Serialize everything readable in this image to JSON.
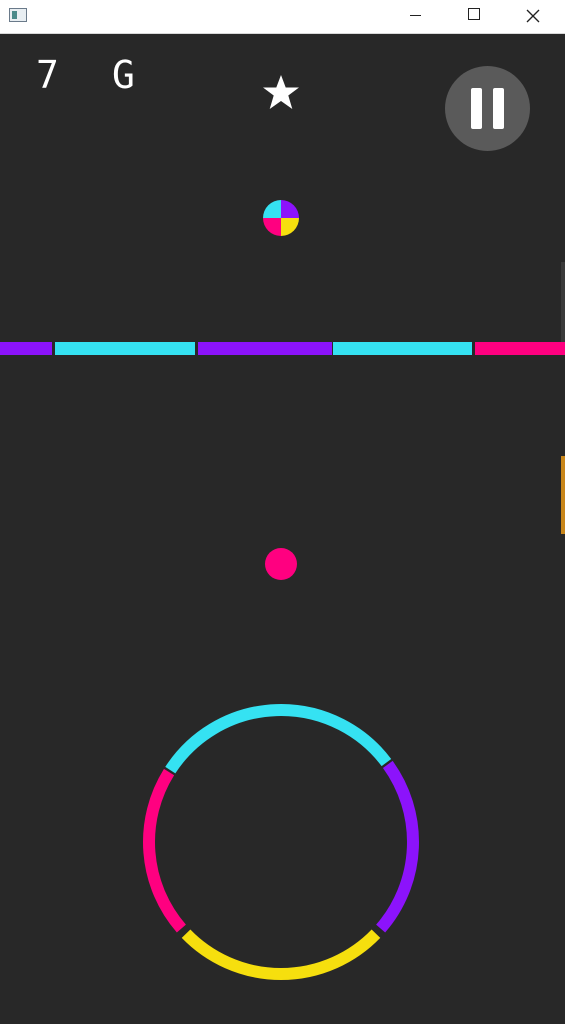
{
  "window": {
    "minimize_icon": "minimize-icon",
    "maximize_icon": "maximize-icon",
    "close_icon": "close-icon"
  },
  "hud": {
    "score": "7",
    "gems": "G",
    "star_icon": "star-icon",
    "pause_icon": "pause-icon"
  },
  "colors": {
    "background": "#282828",
    "cyan": "#35E2F2",
    "purple": "#8C13FB",
    "pink": "#FF0080",
    "yellow": "#F6DF0E",
    "pause_bg": "#5A5A5A"
  },
  "player": {
    "color": "pink"
  },
  "color_switcher": {
    "quadrants": [
      "cyan",
      "purple",
      "pink",
      "yellow"
    ]
  },
  "obstacles": {
    "bar_segments": [
      "purple",
      "cyan",
      "purple",
      "cyan",
      "pink"
    ],
    "ring_arcs": [
      "cyan",
      "purple",
      "yellow",
      "pink"
    ]
  }
}
